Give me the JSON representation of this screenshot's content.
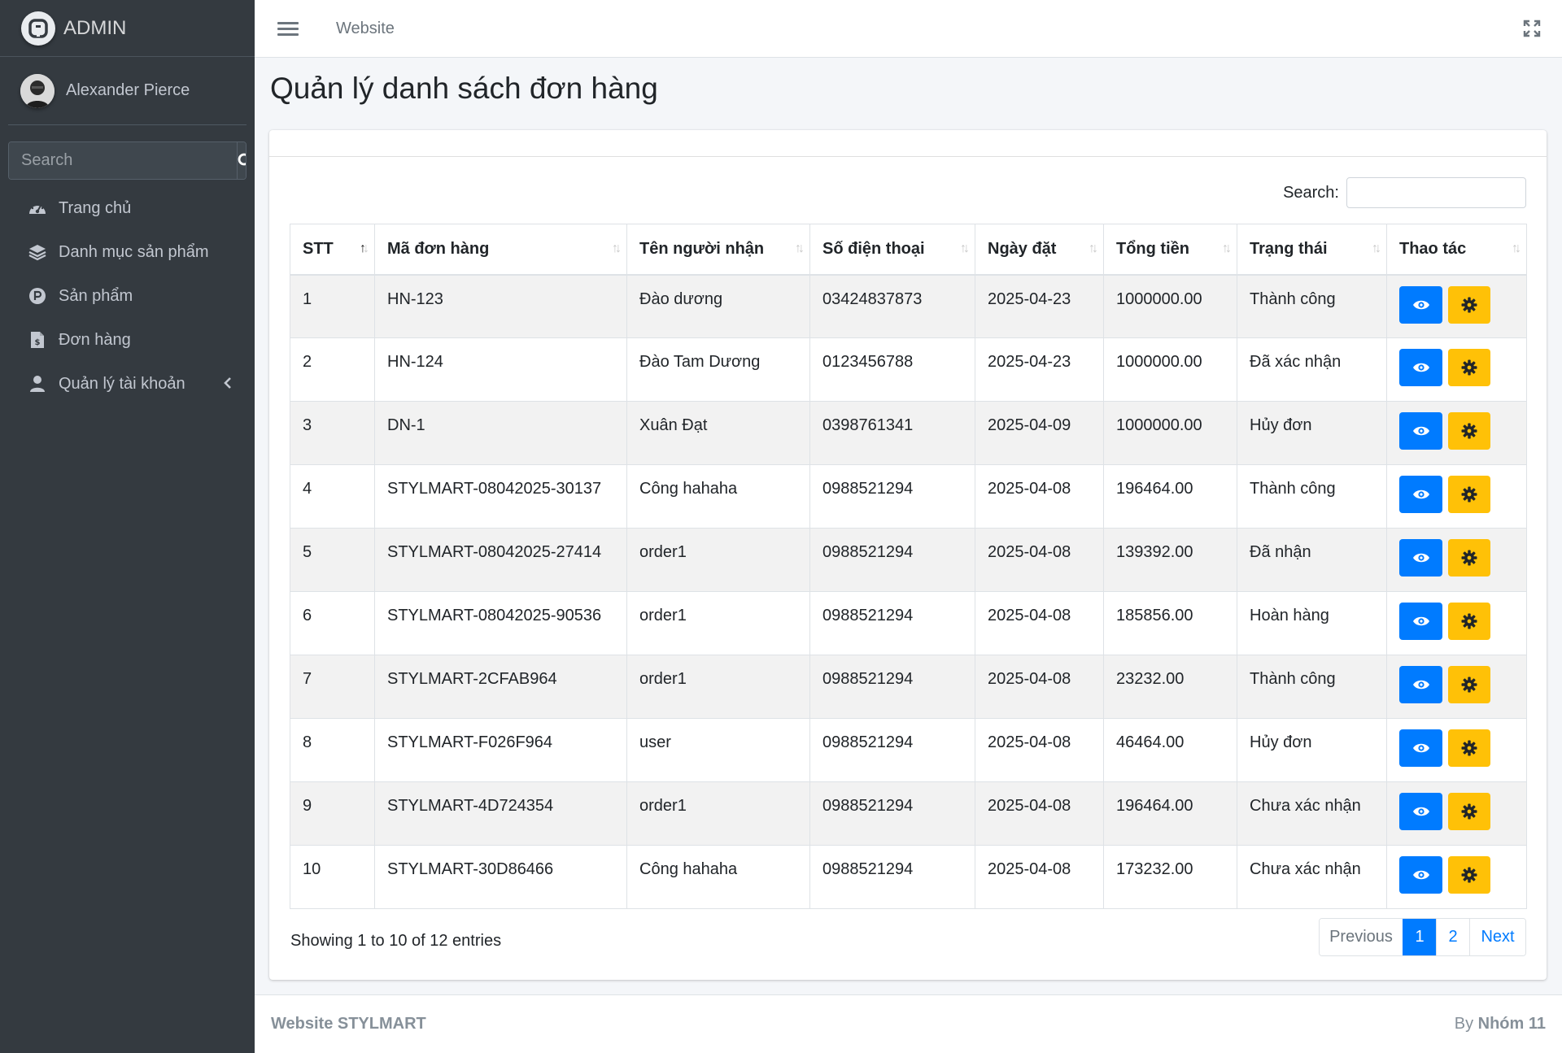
{
  "brand": {
    "title": "ADMIN"
  },
  "user": {
    "name": "Alexander Pierce"
  },
  "sidebar": {
    "search_placeholder": "Search",
    "items": [
      {
        "label": "Trang chủ",
        "icon": "dashboard-icon"
      },
      {
        "label": "Danh mục sản phẩm",
        "icon": "layers-icon"
      },
      {
        "label": "Sản phẩm",
        "icon": "parking-circle-icon"
      },
      {
        "label": "Đơn hàng",
        "icon": "invoice-icon"
      },
      {
        "label": "Quản lý tài khoản",
        "icon": "user-icon"
      }
    ]
  },
  "topbar": {
    "link": "Website"
  },
  "page": {
    "title": "Quản lý danh sách đơn hàng"
  },
  "table": {
    "search_label": "Search:",
    "search_value": "",
    "columns": [
      "STT",
      "Mã đơn hàng",
      "Tên người nhận",
      "Số điện thoại",
      "Ngày đặt",
      "Tổng tiền",
      "Trạng thái",
      "Thao tác"
    ],
    "rows": [
      [
        "1",
        "HN-123",
        "Đào dương",
        "03424837873",
        "2025-04-23",
        "1000000.00",
        "Thành công"
      ],
      [
        "2",
        "HN-124",
        "Đào Tam Dương",
        "0123456788",
        "2025-04-23",
        "1000000.00",
        "Đã xác nhận"
      ],
      [
        "3",
        "DN-1",
        "Xuân Đạt",
        "0398761341",
        "2025-04-09",
        "1000000.00",
        "Hủy đơn"
      ],
      [
        "4",
        "STYLMART-08042025-30137",
        "Công hahaha",
        "0988521294",
        "2025-04-08",
        "196464.00",
        "Thành công"
      ],
      [
        "5",
        "STYLMART-08042025-27414",
        "order1",
        "0988521294",
        "2025-04-08",
        "139392.00",
        "Đã nhận"
      ],
      [
        "6",
        "STYLMART-08042025-90536",
        "order1",
        "0988521294",
        "2025-04-08",
        "185856.00",
        "Hoàn hàng"
      ],
      [
        "7",
        "STYLMART-2CFAB964",
        "order1",
        "0988521294",
        "2025-04-08",
        "23232.00",
        "Thành công"
      ],
      [
        "8",
        "STYLMART-F026F964",
        "user",
        "0988521294",
        "2025-04-08",
        "46464.00",
        "Hủy đơn"
      ],
      [
        "9",
        "STYLMART-4D724354",
        "order1",
        "0988521294",
        "2025-04-08",
        "196464.00",
        "Chưa xác nhận"
      ],
      [
        "10",
        "STYLMART-30D86466",
        "Công hahaha",
        "0988521294",
        "2025-04-08",
        "173232.00",
        "Chưa xác nhận"
      ]
    ],
    "info": "Showing 1 to 10 of 12 entries",
    "pagination": {
      "previous": "Previous",
      "pages": [
        "1",
        "2"
      ],
      "current": "1",
      "next": "Next"
    }
  },
  "footer": {
    "left": "Website STYLMART",
    "right_prefix": "By",
    "right_bold": "Nhóm 11"
  },
  "colors": {
    "sidebar_bg": "#343a40",
    "primary": "#007bff",
    "warning": "#ffc107",
    "content_bg": "#f4f6f9"
  }
}
